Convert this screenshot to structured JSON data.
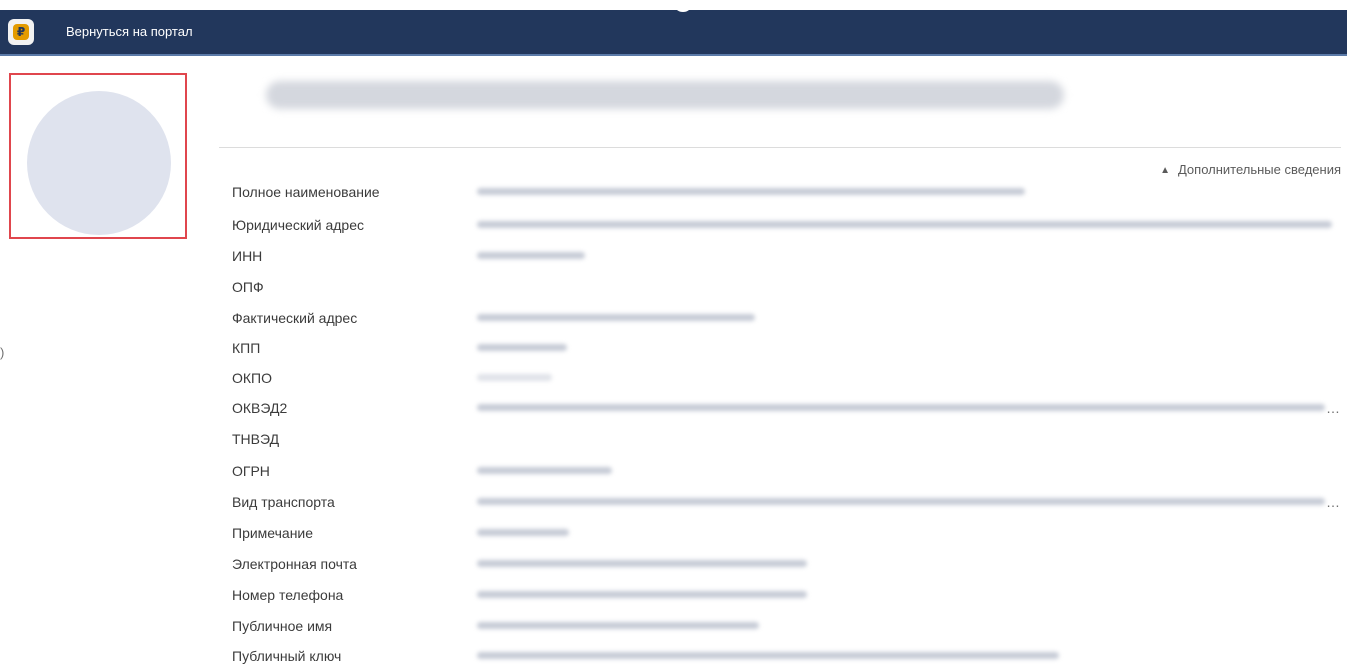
{
  "header": {
    "back_link_label": "Вернуться на портал",
    "logo_letter": "₽",
    "background": "#22375c"
  },
  "profile": {
    "more_info_label": "Дополнительные сведения",
    "fields": [
      {
        "label": "Полное наименование"
      },
      {
        "label": "Юридический адрес"
      },
      {
        "label": "ИНН"
      },
      {
        "label": "ОПФ"
      },
      {
        "label": "Фактический адрес"
      },
      {
        "label": "КПП"
      },
      {
        "label": "ОКПО"
      },
      {
        "label": "ОКВЭД2"
      },
      {
        "label": "ТНВЭД"
      },
      {
        "label": "ОГРН"
      },
      {
        "label": "Вид транспорта"
      },
      {
        "label": "Примечание"
      },
      {
        "label": "Электронная почта"
      },
      {
        "label": "Номер телефона"
      },
      {
        "label": "Публичное имя"
      },
      {
        "label": "Публичный ключ"
      }
    ]
  },
  "side": {
    "edge_icon": ")"
  }
}
